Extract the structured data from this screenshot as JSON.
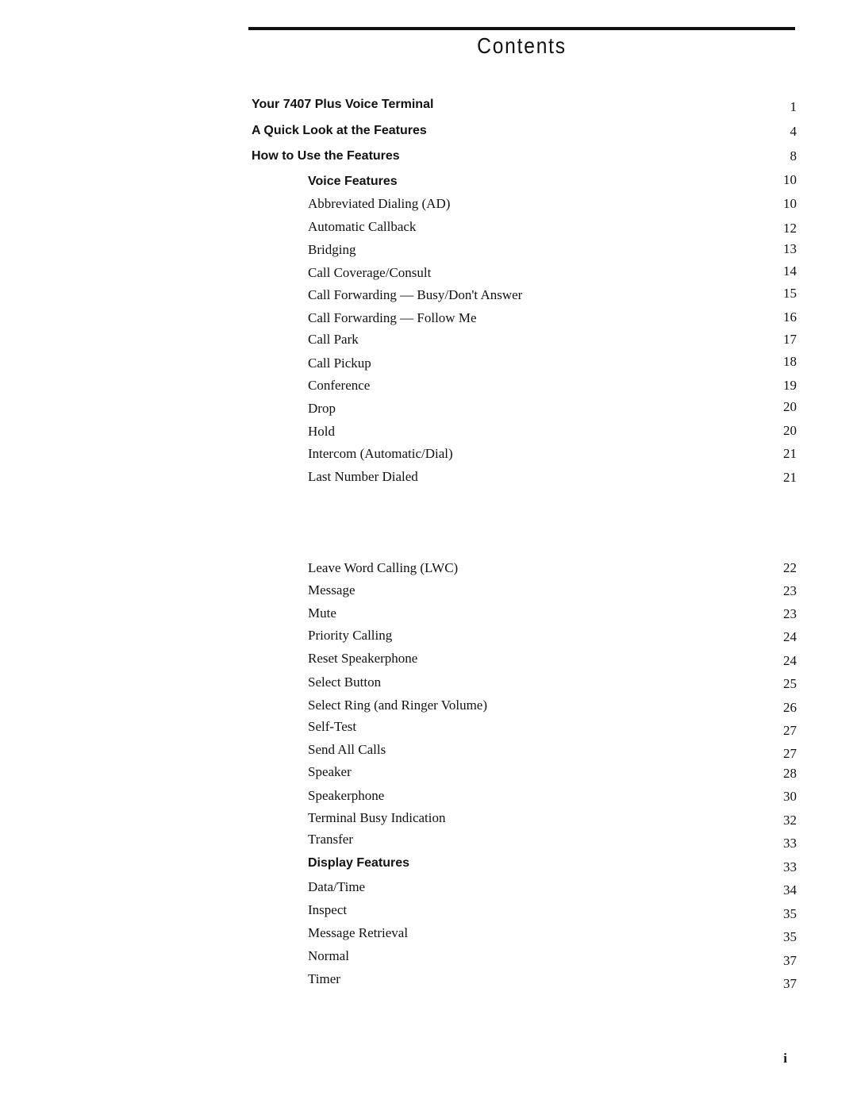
{
  "header": {
    "title": "Contents"
  },
  "toc": [
    {
      "label": "Your 7407 Plus Voice Terminal",
      "page": "1",
      "level": 1
    },
    {
      "label": "A Quick Look at the Features",
      "page": "4",
      "level": 1
    },
    {
      "label": "How to Use the Features",
      "page": "8",
      "level": 1
    },
    {
      "label": "Voice Features",
      "page": "10",
      "level": 2
    },
    {
      "label": "Abbreviated Dialing (AD)",
      "page": "10",
      "level": 3
    },
    {
      "label": "Automatic Callback",
      "page": "12",
      "level": 3
    },
    {
      "label": "Bridging",
      "page": "13",
      "level": 3
    },
    {
      "label": "Call Coverage/Consult",
      "page": "14",
      "level": 3
    },
    {
      "label": "Call Forwarding — Busy/Don't Answer",
      "page": "15",
      "level": 3
    },
    {
      "label": "Call Forwarding — Follow Me",
      "page": "16",
      "level": 3
    },
    {
      "label": "Call Park",
      "page": "17",
      "level": 3
    },
    {
      "label": "Call Pickup",
      "page": "18",
      "level": 3
    },
    {
      "label": "Conference",
      "page": "19",
      "level": 3
    },
    {
      "label": "Drop",
      "page": "20",
      "level": 3
    },
    {
      "label": "Hold",
      "page": "20",
      "level": 3
    },
    {
      "label": "Intercom  (Automatic/Dial)",
      "page": "21",
      "level": 3
    },
    {
      "label": "Last Number Dialed",
      "page": "21",
      "level": 3
    },
    {
      "label": "Leave Word Calling (LWC)",
      "page": "22",
      "level": 3
    },
    {
      "label": "Message",
      "page": "23",
      "level": 3
    },
    {
      "label": "Mute",
      "page": "23",
      "level": 3
    },
    {
      "label": "Priority Calling",
      "page": "24",
      "level": 3
    },
    {
      "label": "Reset Speakerphone",
      "page": "24",
      "level": 3
    },
    {
      "label": "Select Button",
      "page": "25",
      "level": 3
    },
    {
      "label": "Select Ring (and Ringer Volume)",
      "page": "26",
      "level": 3
    },
    {
      "label": "Self-Test",
      "page": "27",
      "level": 3
    },
    {
      "label": "Send All Calls",
      "page": "27",
      "level": 3
    },
    {
      "label": "Speaker",
      "page": "28",
      "level": 3
    },
    {
      "label": "Speakerphone",
      "page": "30",
      "level": 3
    },
    {
      "label": "Terminal Busy Indication",
      "page": "32",
      "level": 3
    },
    {
      "label": "Transfer",
      "page": "33",
      "level": 3
    },
    {
      "label": "Display  Features",
      "page": "33",
      "level": 2
    },
    {
      "label": "Data/Time",
      "page": "34",
      "level": 3
    },
    {
      "label": "Inspect",
      "page": "35",
      "level": 3
    },
    {
      "label": "Message Retrieval",
      "page": "35",
      "level": 3
    },
    {
      "label": "Normal",
      "page": "37",
      "level": 3
    },
    {
      "label": "Timer",
      "page": "37",
      "level": 3
    }
  ],
  "footer": {
    "page_number": "i"
  }
}
